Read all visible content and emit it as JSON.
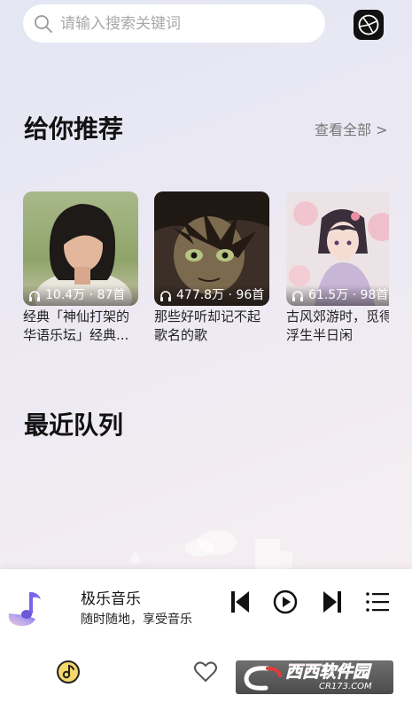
{
  "search": {
    "placeholder": "请输入搜索关键词"
  },
  "recommend": {
    "title": "给你推荐",
    "see_all": "查看全部 >",
    "playlists": [
      {
        "plays": "10.4万 · 87首",
        "title": "经典「神仙打架的华语乐坛」经典..."
      },
      {
        "plays": "477.8万 · 96首",
        "title": "那些好听却记不起歌名的歌"
      },
      {
        "plays": "61.5万 · 98首",
        "title": "古风郊游时，觅得浮生半日闲"
      }
    ]
  },
  "queue": {
    "title": "最近队列"
  },
  "player": {
    "title": "极乐音乐",
    "subtitle": "随时随地，享受音乐",
    "accent": "#7a63e8"
  },
  "tabs": [
    {
      "name": "music",
      "icon": "music-disc-icon",
      "active": true
    },
    {
      "name": "favorites",
      "icon": "heart-icon",
      "active": false
    }
  ],
  "watermark": {
    "text": "西西软件园",
    "url_text": "CR173.COM"
  }
}
